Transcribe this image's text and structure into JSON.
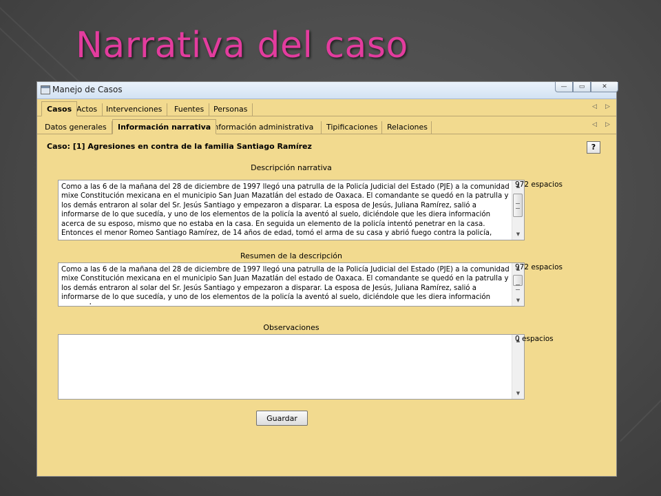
{
  "slide": {
    "title": "Narrativa del caso"
  },
  "window": {
    "title": "Manejo de Casos",
    "controls": {
      "minimize": "—",
      "maximize": "▭",
      "close": "✕"
    }
  },
  "tabs_primary": [
    "Casos",
    "Actos",
    "Intervenciones",
    "Fuentes",
    "Personas"
  ],
  "tabs_secondary": [
    "Datos generales",
    "Información narrativa",
    "Información administrativa",
    "Tipificaciones",
    "Relaciones"
  ],
  "nav_arrows": {
    "left": "◁",
    "right": "▷"
  },
  "case_title": "Caso: [1] Agresiones en contra de la familia Santiago Ramírez",
  "help_label": "?",
  "fields": {
    "descripcion": {
      "label": "Descripción narrativa",
      "text": "Como a las 6 de la mañana del 28 de diciembre de 1997 llegó una patrulla de la Policía Judicial del Estado (PJE) a la comunidad mixe Constitución mexicana en el municipio San Juan Mazatlán del estado de Oaxaca. El comandante se quedó en la patrulla y los demás entraron al solar del Sr. Jesús Santiago y empezaron a disparar. La esposa de Jesús, Juliana Ramírez, salió a informarse de lo que sucedía, y uno de los elementos de la policía la aventó al suelo, diciéndole que les diera información acerca de su esposo, mismo que no estaba en la casa. En seguida un elemento de la policía intentó penetrar en la casa. Entonces el menor Romeo Santiago Ramírez, de 14 años de edad, tomó el arma de su casa y abrió fuego contra la policía, quedando muerto uno de",
      "count": "972 espacios"
    },
    "resumen": {
      "label": "Resumen de la descripción",
      "text": "Como a las 6 de la mañana del 28 de diciembre de 1997 llegó una patrulla de la Policía Judicial del Estado (PJE) a la comunidad mixe Constitución mexicana en el municipio San Juan Mazatlán del estado de Oaxaca. El comandante se quedó en la patrulla y los demás entraron al solar del Sr. Jesús Santiago y empezaron a disparar. La esposa de Jesús, Juliana Ramírez, salió a informarse de lo que sucedía, y uno de los elementos de la policía la aventó al suelo, diciéndole que les diera información acerca de su",
      "count": "972 espacios"
    },
    "observaciones": {
      "label": "Observaciones",
      "text": "",
      "count": "0 espacios"
    }
  },
  "save_label": "Guardar",
  "icons": {
    "scroll_up": "▲",
    "scroll_down": "▼"
  },
  "colors": {
    "title": "#e33c9e",
    "window_bg": "#f2da8f"
  }
}
